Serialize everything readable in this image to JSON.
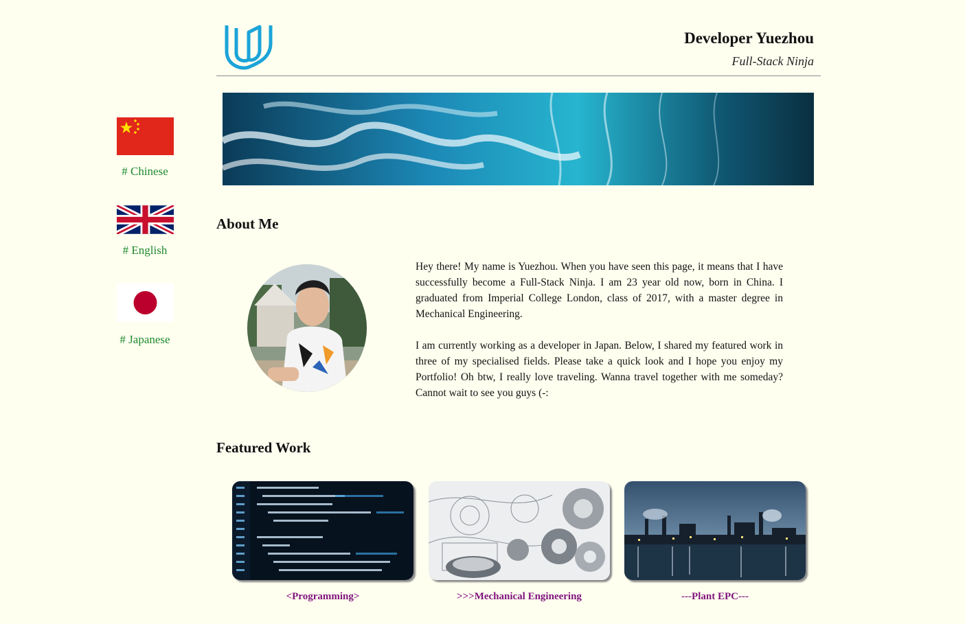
{
  "sidebar": {
    "languages": [
      {
        "label": "# Chinese"
      },
      {
        "label": "# English"
      },
      {
        "label": "# Japanese"
      }
    ]
  },
  "header": {
    "title": "Developer Yuezhou",
    "subtitle": "Full-Stack Ninja",
    "logo_icon": "udacity-logo-icon"
  },
  "about": {
    "heading": "About Me",
    "paragraph1": "Hey there! My name is Yuezhou. When you have seen this page, it means that I have successfully become a Full-Stack Ninja. I am 23 year old now, born in China. I graduated from Imperial College London, class of 2017, with a master degree in Mechanical Engineering.",
    "paragraph2": "I am currently working as a developer in Japan. Below, I shared my featured work in three of my specialised fields. Please take a quick look and I hope you enjoy my Portfolio! Oh btw, I really love traveling. Wanna travel together with me someday? Cannot wait to see you guys (-:"
  },
  "featured": {
    "heading": "Featured Work",
    "items": [
      {
        "label": "<Programming>"
      },
      {
        "label": ">>>Mechanical Engineering"
      },
      {
        "label": "---Plant EPC---"
      }
    ]
  },
  "colors": {
    "background": "#fffff0",
    "language_link": "#1e8a2e",
    "work_caption": "#80157e",
    "logo": "#1ba4d8"
  }
}
